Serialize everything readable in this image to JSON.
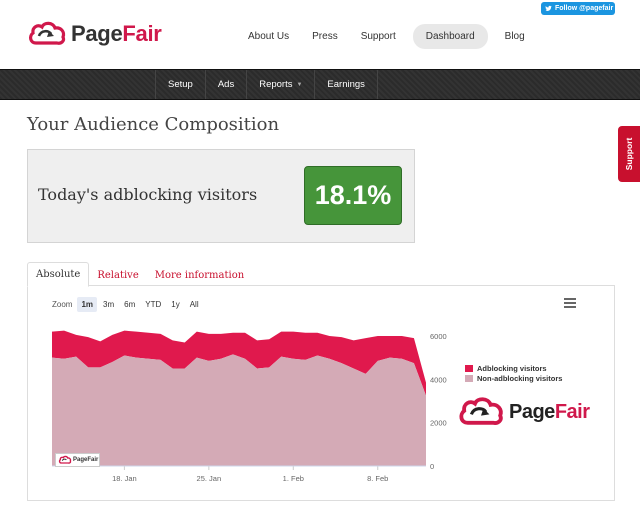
{
  "header": {
    "twitter_follow": "Follow @pagefair",
    "logo": {
      "part1": "Page",
      "part2": "Fair",
      "brand_color": "#d0184b"
    },
    "nav": [
      {
        "label": "About Us"
      },
      {
        "label": "Press"
      },
      {
        "label": "Support"
      },
      {
        "label": "Dashboard",
        "active": true
      },
      {
        "label": "Blog"
      }
    ]
  },
  "subnav": [
    {
      "label": "Setup"
    },
    {
      "label": "Ads"
    },
    {
      "label": "Reports",
      "dropdown": true
    },
    {
      "label": "Earnings"
    }
  ],
  "page_title": "Your Audience Composition",
  "stat": {
    "label": "Today's adblocking visitors",
    "value": "18.1%",
    "value_color": "#46953a"
  },
  "support_tab": {
    "label": "Support",
    "color": "#c8102e"
  },
  "tabs": [
    {
      "label": "Absolute",
      "active": true
    },
    {
      "label": "Relative"
    },
    {
      "label": "More information"
    }
  ],
  "zoom": {
    "label": "Zoom",
    "options": [
      {
        "label": "1m",
        "active": true
      },
      {
        "label": "3m"
      },
      {
        "label": "6m"
      },
      {
        "label": "YTD"
      },
      {
        "label": "1y"
      },
      {
        "label": "All"
      }
    ]
  },
  "chart_data": {
    "type": "area",
    "stacked": true,
    "x": [
      "Jan 12",
      "Jan 13",
      "Jan 14",
      "Jan 15",
      "Jan 16",
      "Jan 17",
      "Jan 18",
      "Jan 19",
      "Jan 20",
      "Jan 21",
      "Jan 22",
      "Jan 23",
      "Jan 24",
      "Jan 25",
      "Jan 26",
      "Jan 27",
      "Jan 28",
      "Jan 29",
      "Jan 30",
      "Jan 31",
      "Feb 1",
      "Feb 2",
      "Feb 3",
      "Feb 4",
      "Feb 5",
      "Feb 6",
      "Feb 7",
      "Feb 8",
      "Feb 9",
      "Feb 10",
      "Feb 11",
      "Feb 12"
    ],
    "xticks": [
      "18. Jan",
      "25. Jan",
      "1. Feb",
      "8. Feb"
    ],
    "yticks": [
      0,
      2000,
      4000,
      6000
    ],
    "ylim": [
      0,
      6000
    ],
    "y_axis_side": "right",
    "series": [
      {
        "name": "Non-adblocking visitors",
        "color": "#d4aab6",
        "values": [
          5000,
          4950,
          5050,
          4550,
          4550,
          4800,
          5100,
          5000,
          4950,
          4900,
          4500,
          4500,
          5000,
          4850,
          4950,
          5150,
          4950,
          4500,
          4550,
          5050,
          4950,
          4900,
          5100,
          4950,
          4750,
          4500,
          4250,
          4850,
          5000,
          4950,
          4750,
          3250
        ]
      },
      {
        "name": "Adblocking visitors",
        "color": "#e0194d",
        "values": [
          1200,
          1300,
          1000,
          1400,
          1200,
          1250,
          1150,
          1200,
          1200,
          1200,
          1300,
          1200,
          1200,
          1250,
          1150,
          1000,
          1200,
          1300,
          1300,
          1150,
          1250,
          1250,
          1050,
          1050,
          1200,
          1300,
          1650,
          1150,
          1000,
          1050,
          1150,
          600
        ]
      }
    ]
  },
  "chart_logo": {
    "part1": "Page",
    "part2": "Fair"
  },
  "mini_logo": "PageFair"
}
